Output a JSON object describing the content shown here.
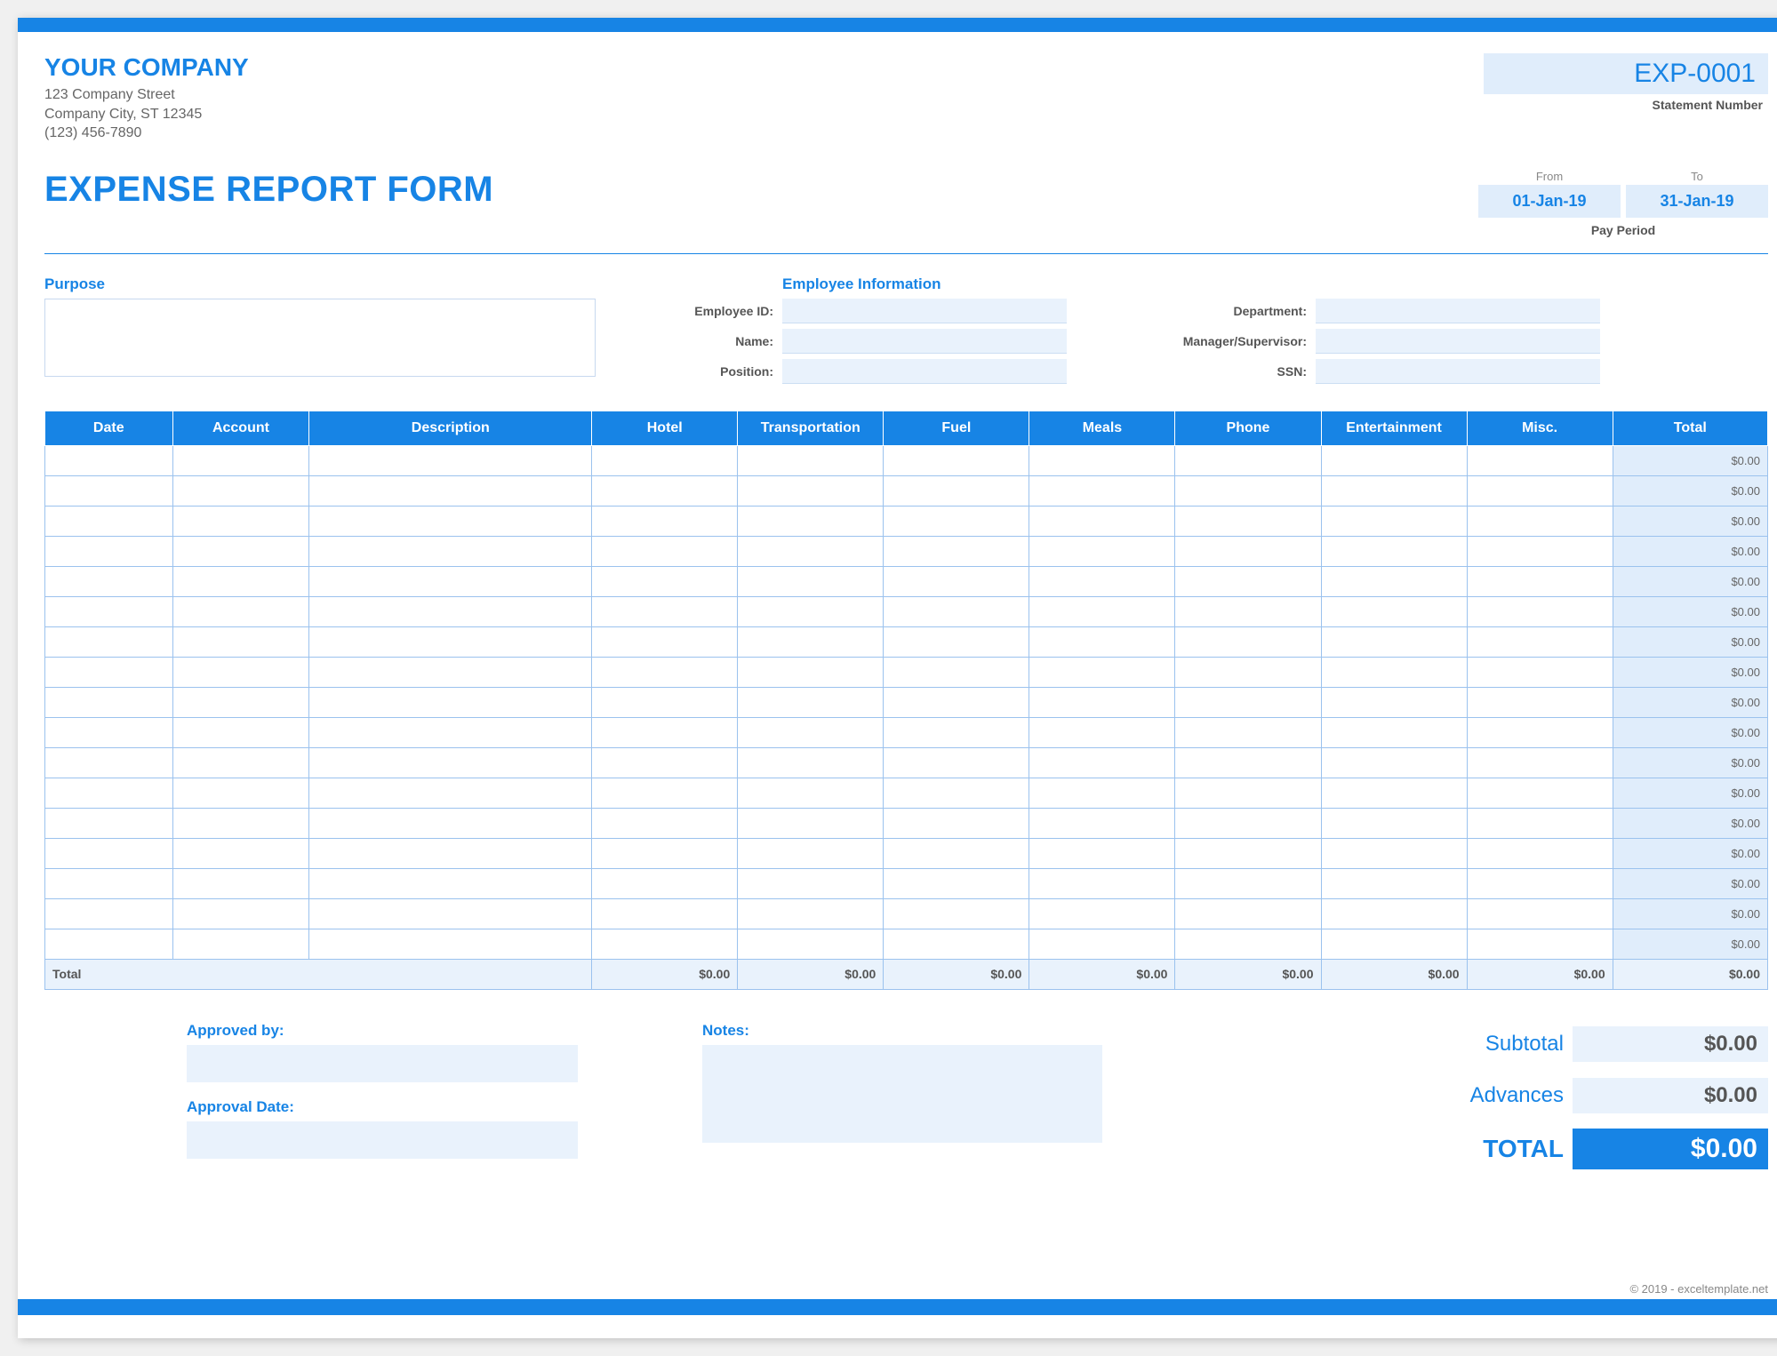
{
  "company": {
    "name": "YOUR COMPANY",
    "street": "123 Company Street",
    "city": "Company City, ST 12345",
    "phone": "(123) 456-7890"
  },
  "statement": {
    "number": "EXP-0001",
    "label": "Statement Number"
  },
  "form_title": "EXPENSE REPORT FORM",
  "period": {
    "from_label": "From",
    "to_label": "To",
    "from": "01-Jan-19",
    "to": "31-Jan-19",
    "caption": "Pay Period"
  },
  "purpose_label": "Purpose",
  "employee": {
    "heading": "Employee Information",
    "fields": [
      {
        "left_label": "Employee ID:",
        "right_label": "Department:"
      },
      {
        "left_label": "Name:",
        "right_label": "Manager/Supervisor:"
      },
      {
        "left_label": "Position:",
        "right_label": "SSN:"
      }
    ]
  },
  "table": {
    "headers": [
      "Date",
      "Account",
      "Description",
      "Hotel",
      "Transportation",
      "Fuel",
      "Meals",
      "Phone",
      "Entertainment",
      "Misc.",
      "Total"
    ],
    "row_count": 17,
    "row_total": "$0.00",
    "footer_label": "Total",
    "footer_vals": [
      "$0.00",
      "$0.00",
      "$0.00",
      "$0.00",
      "$0.00",
      "$0.00",
      "$0.00",
      "$0.00"
    ]
  },
  "approval": {
    "approved_by": "Approved by:",
    "approval_date": "Approval Date:"
  },
  "notes_label": "Notes:",
  "totals": {
    "subtotal_label": "Subtotal",
    "subtotal": "$0.00",
    "advances_label": "Advances",
    "advances": "$0.00",
    "total_label": "TOTAL",
    "total": "$0.00"
  },
  "copyright": "© 2019 - exceltemplate.net"
}
